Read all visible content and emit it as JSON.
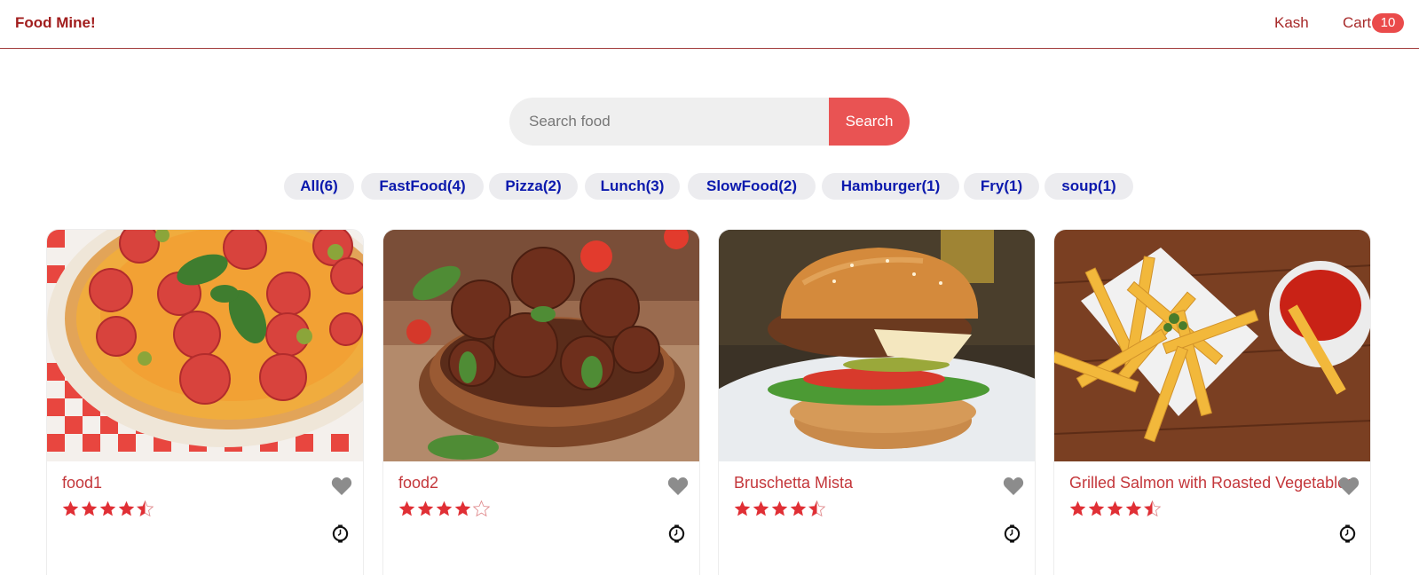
{
  "header": {
    "logo": "Food Mine!",
    "user": "Kash",
    "cart_label": "Cart",
    "cart_count": "10"
  },
  "search": {
    "placeholder": "Search food",
    "value": "",
    "button_label": "Search"
  },
  "tags": [
    {
      "label": "All(6)"
    },
    {
      "label": "FastFood(4)"
    },
    {
      "label": "Pizza(2)"
    },
    {
      "label": "Lunch(3)"
    },
    {
      "label": "SlowFood(2)"
    },
    {
      "label": "Hamburger(1)"
    },
    {
      "label": "Fry(1)"
    },
    {
      "label": "soup(1)"
    }
  ],
  "foods": [
    {
      "name": "food1",
      "stars": 4.5,
      "image": "pizza-image"
    },
    {
      "name": "food2",
      "stars": 4,
      "image": "meatballs-image"
    },
    {
      "name": "Bruschetta Mista",
      "stars": 4.5,
      "image": "burger-image"
    },
    {
      "name": "Grilled Salmon with Roasted Vegetables",
      "stars": 4.5,
      "image": "fries-image"
    }
  ],
  "icons": {
    "favorite": "heart-icon",
    "cook_time": "clock-icon",
    "rating": "star-icon"
  },
  "colors": {
    "accent": "#e95353",
    "brand": "#a11d1d",
    "tag_text": "#0b19ad",
    "food_name": "#c4373b",
    "star": "#e02f35",
    "heart": "#8c8c8c"
  }
}
